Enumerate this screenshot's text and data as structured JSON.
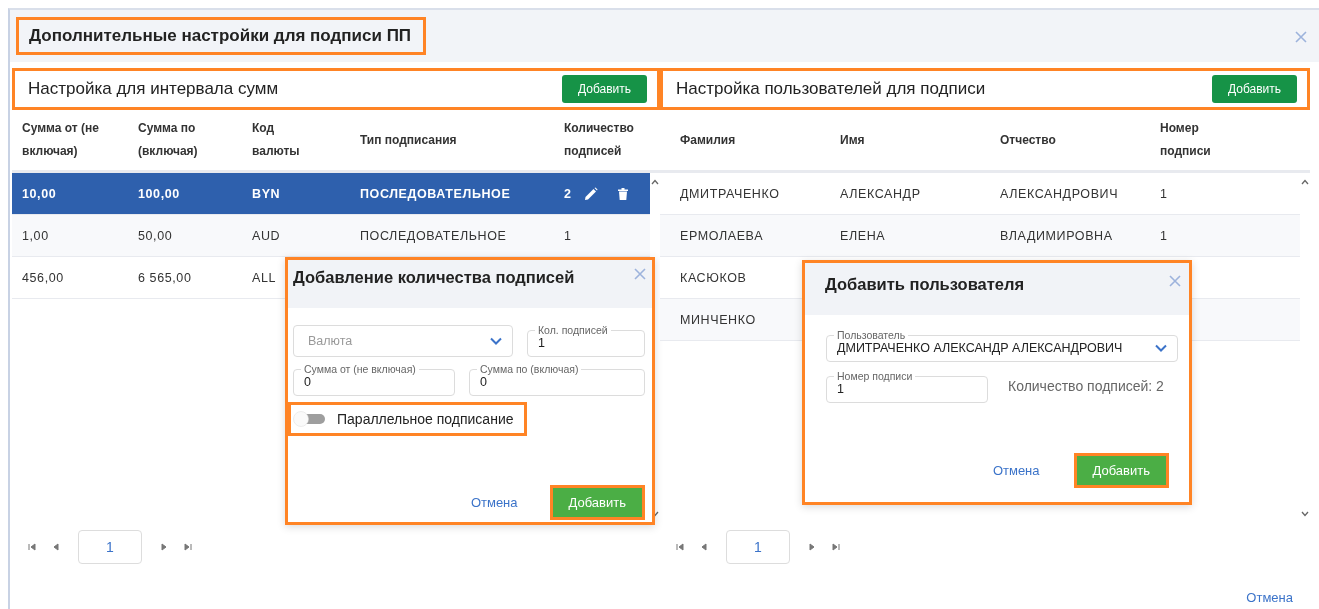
{
  "dialog": {
    "title": "Дополнительные настройки для подписи ПП",
    "highlighted": true
  },
  "amounts": {
    "title": "Настройка для интервала сумм",
    "highlighted": true,
    "add_button": "Добавить",
    "columns": [
      "Сумма от (не включая)",
      "Сумма по (включая)",
      "Код валюты",
      "Тип подписания",
      "Количество подписей"
    ],
    "rows": [
      {
        "cells": [
          "10,00",
          "100,00",
          "BYN",
          "ПОСЛЕДОВАТЕЛЬНОЕ",
          "2"
        ],
        "selected": true
      },
      {
        "cells": [
          "1,00",
          "50,00",
          "AUD",
          "ПОСЛЕДОВАТЕЛЬНОЕ",
          "1"
        ],
        "selected": false
      },
      {
        "cells": [
          "456,00",
          "6 565,00",
          "ALL"
        ],
        "selected": false
      }
    ],
    "page": "1"
  },
  "users": {
    "title": "Настройка пользователей для подписи",
    "highlighted": true,
    "add_button": "Добавить",
    "columns": [
      "Фамилия",
      "Имя",
      "Отчество",
      "Номер подписи"
    ],
    "rows": [
      {
        "cells": [
          "ДМИТРАЧЕНКО",
          "АЛЕКСАНДР",
          "АЛЕКСАНДРОВИЧ",
          "1"
        ],
        "selected": false
      },
      {
        "cells": [
          "ЕРМОЛАЕВА",
          "ЕЛЕНА",
          "ВЛАДИМИРОВНА",
          "1"
        ],
        "selected": false
      },
      {
        "cells": [
          "КАСЮКОВ"
        ],
        "selected": false
      },
      {
        "cells": [
          "МИНЧЕНКО"
        ],
        "selected": false
      }
    ],
    "page": "1"
  },
  "count_dialog": {
    "title": "Добавление количества подписей",
    "highlighted": true,
    "currency": {
      "placeholder": "Валюта"
    },
    "count": {
      "label": "Кол. подписей",
      "value": "1"
    },
    "sum_from": {
      "label": "Сумма от (не включая)",
      "value": "0"
    },
    "sum_to": {
      "label": "Сумма по (включая)",
      "value": "0"
    },
    "parallel": {
      "label": "Параллельное подписание",
      "on": false,
      "highlighted": true
    },
    "cancel": "Отмена",
    "add": {
      "label": "Добавить",
      "highlighted": true
    }
  },
  "user_dialog": {
    "title": "Добавить пользователя",
    "highlighted": true,
    "user": {
      "label": "Пользователь",
      "value": "ДМИТРАЧЕНКО АЛЕКСАНДР АЛЕКСАНДРОВИЧ"
    },
    "number": {
      "label": "Номер подписи",
      "value": "1"
    },
    "count_text": "Количество подписей: 2",
    "cancel": "Отмена",
    "add": {
      "label": "Добавить",
      "highlighted": true
    }
  },
  "footer": {
    "cancel": "Отмена"
  }
}
